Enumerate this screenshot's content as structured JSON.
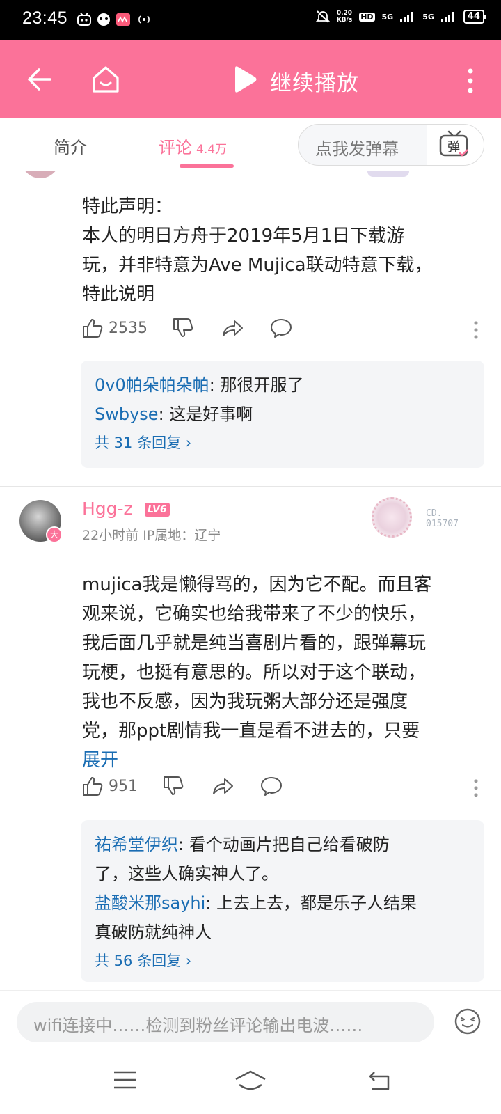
{
  "status_bar": {
    "time": "23:45",
    "net_speed_value": "0.20",
    "net_speed_unit": "KB/s",
    "hd_label": "HD",
    "network1": "5G",
    "network2": "5G",
    "battery": "44"
  },
  "top_bar": {
    "title": "继续播放",
    "accent_color": "#fb7299"
  },
  "tabs": {
    "intro": "简介",
    "comments": "评论",
    "comments_count": "4.4万",
    "danmaku_placeholder": "点我发弹幕",
    "danmaku_button": "弹"
  },
  "comments": [
    {
      "lines": [
        "特此声明：",
        "本人的明日方舟于2019年5月1日下载游",
        "玩，并非特意为Ave Mujica联动特意下载，",
        "特此说明"
      ],
      "likes": "2535",
      "replies": [
        {
          "user": "0v0帕朵帕朵帕",
          "text": ": 那很开服了"
        },
        {
          "user": "Swbyse",
          "text": ": 这是好事啊"
        }
      ],
      "reply_total": "共 31 条回复 ›"
    },
    {
      "username": "Hgg-z",
      "level": "LV6",
      "avatar_badge": "大",
      "meta": "22小时前 IP属地：辽宁",
      "fan_no_line1": "CD.",
      "fan_no_line2": "015707",
      "lines": [
        "mujica我是懒得骂的，因为它不配。而且客",
        "观来说，它确实也给我带来了不少的快乐，",
        "我后面几乎就是纯当喜剧片看的，跟弹幕玩",
        "玩梗，也挺有意思的。所以对于这个联动，",
        "我也不反感，因为我玩粥大部分还是强度",
        "党，那ppt剧情我一直是看不进去的，只要"
      ],
      "expand": "展开",
      "likes": "951",
      "replies": [
        {
          "user": "祐希堂伊织",
          "text": ": 看个动画片把自己给看破防",
          "text2": "了，这些人确实神人了。"
        },
        {
          "user": "盐酸米那sayhi",
          "text": ": 上去上去，都是乐子人结果",
          "text2": "真破防就纯神人"
        }
      ],
      "reply_total": "共 56 条回复 ›"
    }
  ],
  "bottom_input": {
    "placeholder": "wifi连接中……检测到粉丝评论输出电波……"
  }
}
